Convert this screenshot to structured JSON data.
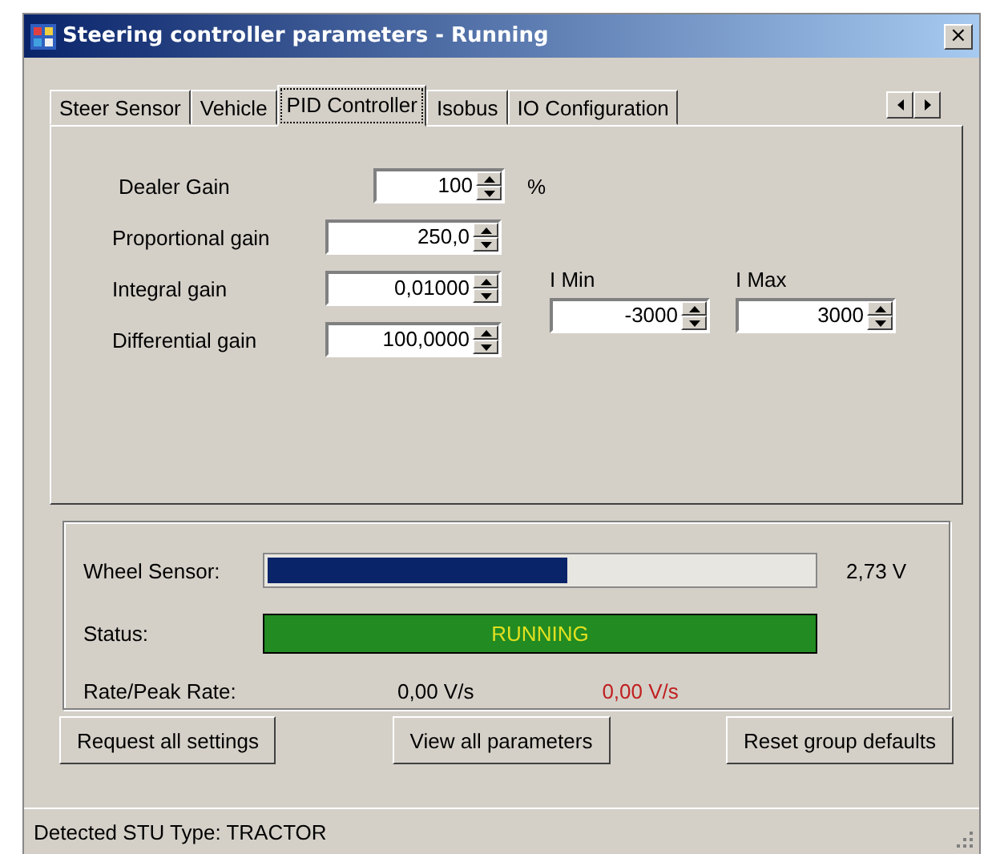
{
  "window": {
    "title": "Steering controller parameters - Running",
    "close": "×"
  },
  "tabs": [
    {
      "label": "Steer Sensor",
      "selected": false
    },
    {
      "label": "Vehicle",
      "selected": false
    },
    {
      "label": "PID Controller",
      "selected": true
    },
    {
      "label": "Isobus",
      "selected": false
    },
    {
      "label": "IO Configuration",
      "selected": false
    }
  ],
  "dealer_gain": {
    "label": "Dealer Gain",
    "value": "100",
    "unit": "%"
  },
  "gains": [
    {
      "label": "Proportional gain",
      "value": "250,0"
    },
    {
      "label": "Integral gain",
      "value": "0,01000"
    },
    {
      "label": "Differential gain",
      "value": "100,0000"
    }
  ],
  "i_limits": [
    {
      "label": "I Min",
      "value": "-3000"
    },
    {
      "label": "I Max",
      "value": "3000"
    }
  ],
  "wheel_sensor": {
    "label": "Wheel Sensor:",
    "level": 0.55,
    "reading": "2,73 V"
  },
  "status": {
    "label": "Status:",
    "text": "RUNNING"
  },
  "rate": {
    "label": "Rate/Peak Rate:",
    "rate": "0,00 V/s",
    "peak_rate": "0,00 V/s"
  },
  "buttons": [
    "Request all settings",
    "View all parameters",
    "Reset group defaults"
  ],
  "status_bar": "Detected STU Type: TRACTOR"
}
